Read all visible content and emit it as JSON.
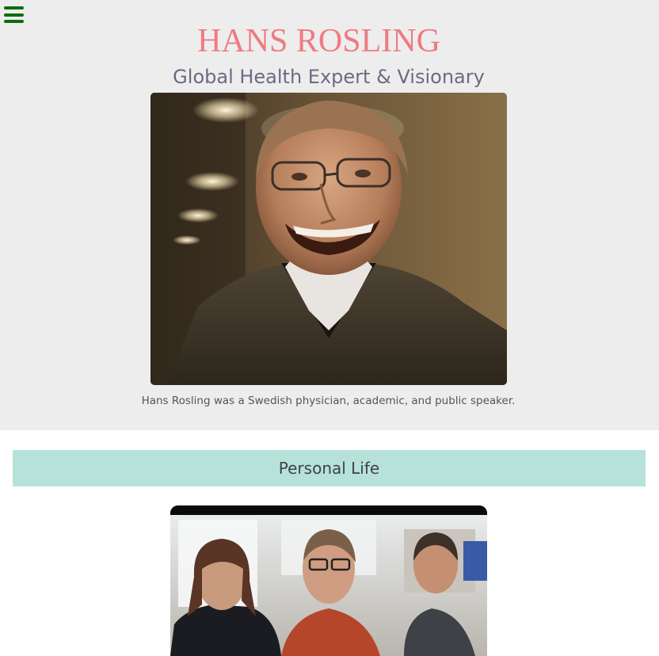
{
  "header": {
    "title": "HANS ROSLING",
    "subtitle": "Global Health Expert & Visionary",
    "caption": "Hans Rosling was a Swedish physician, academic, and public speaker."
  },
  "menu": {
    "icon": "hamburger-menu-icon",
    "color": "#0d6e0d"
  },
  "sections": [
    {
      "heading": "Personal Life",
      "background": "#b7e2da"
    }
  ],
  "colors": {
    "header_bg": "#eeeded",
    "title": "#ee7b80",
    "subtitle": "#6b6a86",
    "caption": "#555555"
  }
}
